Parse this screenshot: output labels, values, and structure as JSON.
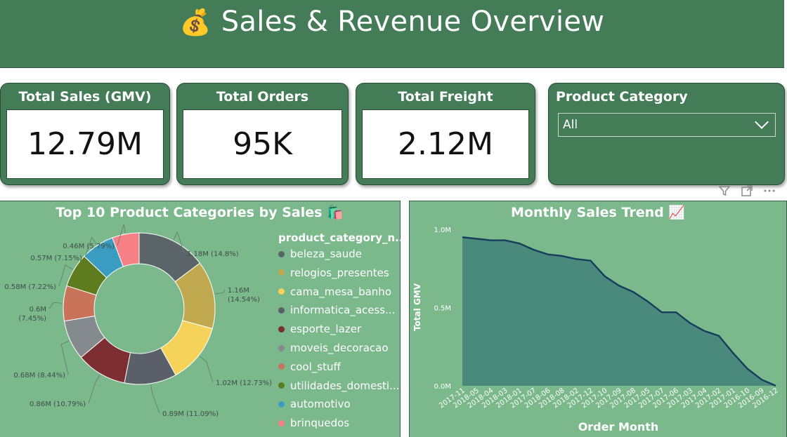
{
  "header": {
    "emoji": "💰",
    "title": "Sales & Revenue Overview"
  },
  "kpis": [
    {
      "title": "Total Sales (GMV)",
      "value": "12.79M"
    },
    {
      "title": "Total Orders",
      "value": "95K"
    },
    {
      "title": "Total Freight",
      "value": "2.12M"
    }
  ],
  "slicer": {
    "title": "Product Category",
    "selected": "All"
  },
  "toolbar": {
    "icons": [
      "filter-icon",
      "focus-mode-icon",
      "more-options-icon"
    ]
  },
  "donut": {
    "title": "Top 10 Product Categories by Sales 🛍️",
    "legend_title": "product_category_n...",
    "legend": [
      "beleza_saude",
      "relogios_presentes",
      "cama_mesa_banho",
      "informatica_acess...",
      "esporte_lazer",
      "moveis_decoracao",
      "cool_stuff",
      "utilidades_domesti...",
      "automotivo",
      "brinquedos"
    ]
  },
  "trend": {
    "title": "Monthly Sales Trend 📈",
    "xlabel": "Order Month",
    "ylabel": "Total GMV",
    "yticks": [
      "1.0M",
      "0.5M",
      "0.0M"
    ]
  },
  "colors": {
    "header": "#437c56",
    "panel": "#7bb88c",
    "area_fill": "#4a8a7c",
    "area_line": "#163e5c"
  },
  "chart_data": [
    {
      "type": "pie",
      "variant": "donut",
      "title": "Top 10 Product Categories by Sales 🛍️",
      "legend_title": "product_category_n...",
      "categories": [
        "beleza_saude",
        "relogios_presentes",
        "cama_mesa_banho",
        "informatica_acess...",
        "esporte_lazer",
        "moveis_decoracao",
        "cool_stuff",
        "utilidades_domesti...",
        "automotivo",
        "brinquedos"
      ],
      "values": [
        1.18,
        1.16,
        1.02,
        0.89,
        0.86,
        0.68,
        0.6,
        0.58,
        0.57,
        0.46
      ],
      "labels": [
        "1.18M (14.8%)",
        "1.16M (14.54%)",
        "1.02M (12.73%)",
        "0.89M (11.09%)",
        "0.86M (10.79%)",
        "0.68M (8.44%)",
        "0.6M (7.45%)",
        "0.58M (7.22%)",
        "0.57M (7.15%)",
        "0.46M (5.79%)"
      ],
      "colors": [
        "#5b6569",
        "#c0a84e",
        "#f5d25a",
        "#5a5f68",
        "#7d2e33",
        "#858a8f",
        "#c9745a",
        "#5e7b1e",
        "#3b9cc2",
        "#f77f86"
      ],
      "legend_position": "right"
    },
    {
      "type": "area",
      "title": "Monthly Sales Trend 📈",
      "xlabel": "Order Month",
      "ylabel": "Total GMV",
      "x": [
        "2017-11",
        "2018-05",
        "2018-04",
        "2018-03",
        "2018-01",
        "2017-07",
        "2018-06",
        "2018-08",
        "2018-02",
        "2017-12",
        "2017-10",
        "2017-09",
        "2017-08",
        "2017-05",
        "2017-07",
        "2017-06",
        "2017-03",
        "2017-04",
        "2017-02",
        "2017-01",
        "2016-10",
        "2016-09",
        "2016-12"
      ],
      "values": [
        0.95,
        0.94,
        0.93,
        0.93,
        0.91,
        0.87,
        0.84,
        0.83,
        0.81,
        0.8,
        0.7,
        0.64,
        0.6,
        0.54,
        0.47,
        0.47,
        0.4,
        0.35,
        0.32,
        0.21,
        0.11,
        0.04,
        0.0
      ],
      "ylim": [
        0,
        1.0
      ],
      "y_unit": "M",
      "grid": false
    }
  ]
}
